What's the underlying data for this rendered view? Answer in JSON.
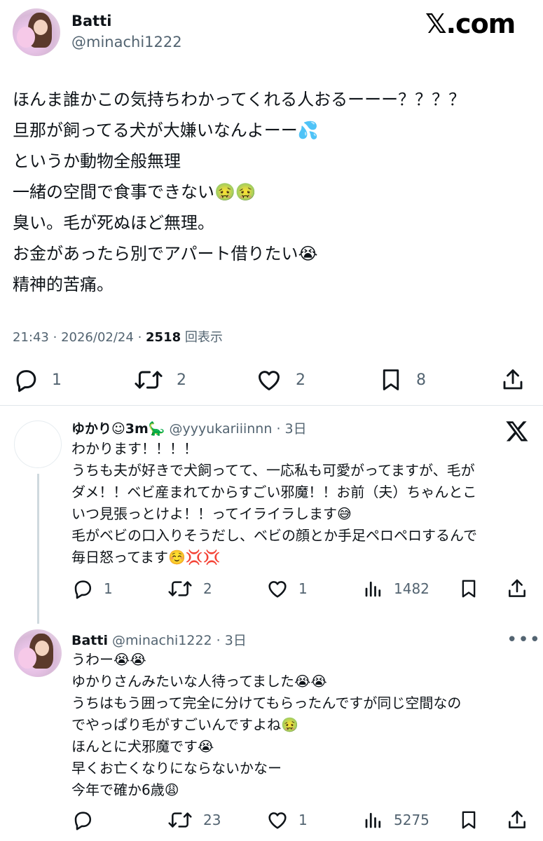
{
  "site_logo": "𝕏.com",
  "main_post": {
    "author_name": "Batti",
    "author_handle": "@minachi1222",
    "lines": [
      "ほんま誰かこの気持ちわかってくれる人おるーーー？？？？",
      "旦那が飼ってる犬が大嫌いなんよーー💦",
      "というか動物全般無理",
      "一緒の空間で食事できない🤢🤢",
      "臭い。毛が死ぬほど無理。",
      "お金があったら別でアパート借りたい😭",
      "精神的苦痛。"
    ],
    "time": "21:43",
    "date": "2026/02/24",
    "views_count": "2518",
    "views_label": "回表示",
    "reply_count": "1",
    "repost_count": "2",
    "like_count": "2",
    "bookmark_count": "8"
  },
  "replies": [
    {
      "author_name": "ゆかり☺︎3m🦕",
      "author_handle": "@yyyukariiinnn",
      "time_ago": "3日",
      "lines": [
        "わかります！！！！",
        "うちも夫が好きで犬飼ってて、一応私も可愛がってますが、毛が",
        "ダメ！！ベビ産まれてからすごい邪魔！！お前（夫）ちゃんとこ",
        "いつ見張っとけよ！！ってイライラします😅",
        "毛がベビの口入りそうだし、ベビの顔とか手足ペロペロするんで",
        "毎日怒ってます☺️💢💢"
      ],
      "reply_count": "1",
      "repost_count": "2",
      "like_count": "1",
      "views_count": "1482"
    },
    {
      "author_name": "Batti",
      "author_handle": "@minachi1222",
      "time_ago": "3日",
      "lines": [
        "うわー😭😭",
        "ゆかりさんみたいな人待ってました😭😭",
        "うちはもう囲って完全に分けてもらったんですが同じ空間なの",
        "でやっぱり毛がすごいんですよね🤢",
        "ほんとに犬邪魔です😭",
        "早くお亡くなりにならないかなー",
        "今年で確か6歳😩"
      ],
      "reply_count": "",
      "repost_count": "23",
      "like_count": "1",
      "views_count": "5275"
    }
  ],
  "separator": "·",
  "icons": {
    "reply": "reply-icon",
    "repost": "repost-icon",
    "like": "heart-icon",
    "bookmark": "bookmark-icon",
    "share": "share-icon",
    "views": "views-icon",
    "x_logo": "x-logo-icon",
    "more": "more-icon"
  }
}
